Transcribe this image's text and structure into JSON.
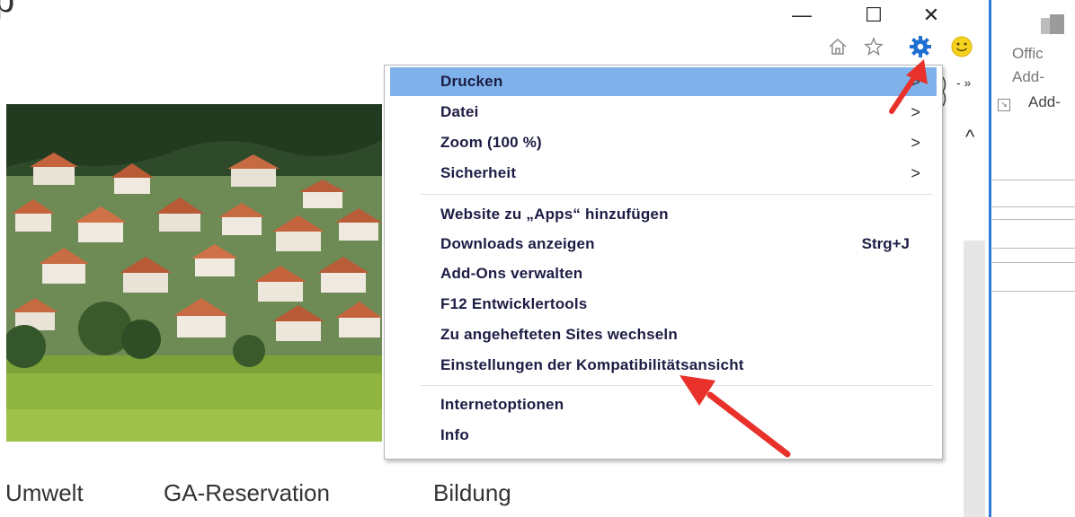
{
  "page": {
    "heading_fragment": "p",
    "nav": [
      "Umwelt",
      "GA-Reservation",
      "Bildung"
    ]
  },
  "window_controls": {
    "minimize": "—",
    "maximize": "☐",
    "close": "✕"
  },
  "toolbar": {
    "icons": [
      "home-icon",
      "star-icon",
      "gear-icon",
      "smiley-icon"
    ]
  },
  "menu": {
    "items": [
      {
        "label": "Drucken",
        "arrow": ">",
        "highlighted": true
      },
      {
        "label": "Datei",
        "arrow": ">"
      },
      {
        "label": "Zoom (100 %)",
        "arrow": ">"
      },
      {
        "label": "Sicherheit",
        "arrow": ">"
      },
      {
        "label": "Website zu „Apps“ hinzufügen"
      },
      {
        "label": "Downloads anzeigen",
        "shortcut": "Strg+J"
      },
      {
        "label": "Add-Ons verwalten"
      },
      {
        "label": "F12 Entwicklertools"
      },
      {
        "label": "Zu angehefteten Sites wechseln"
      },
      {
        "label": "Einstellungen der Kompatibilitätsansicht"
      },
      {
        "label": "Internetoptionen"
      },
      {
        "label": "Info"
      }
    ]
  },
  "office_panel": {
    "line1": "Offic",
    "line2": "Add-",
    "line3": "Add-"
  },
  "colors": {
    "menu_highlight": "#7fb2ea",
    "annotation_arrow": "#e8312a",
    "accent_line": "#2e7ad4",
    "gear_blue": "#1e6fd0"
  }
}
